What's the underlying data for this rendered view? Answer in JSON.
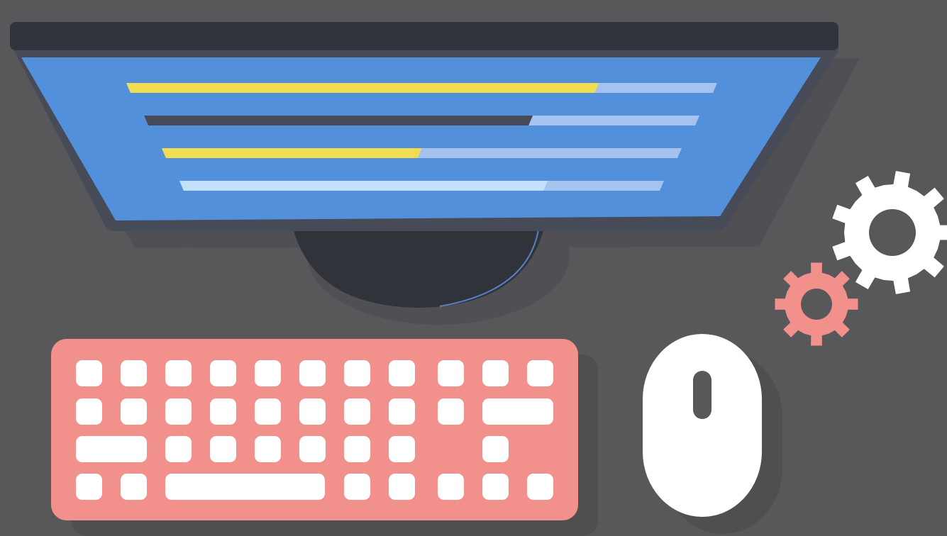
{
  "scene": {
    "colors": {
      "background": "#58585a",
      "monitor_frame": "#474b58",
      "monitor_top": "#31343c",
      "screen": "#5390db",
      "stand": "#31333b",
      "keyboard": "#f2918c",
      "keys": "#ffffff",
      "mouse": "#ffffff",
      "gear_large": "#ffffff",
      "gear_small": "#f2918c",
      "bar_yellow": "#f1dc52",
      "bar_dark": "#474b58",
      "bar_light": "#c4e1fb",
      "bar_track": "#a6c3ef"
    },
    "screen_bars": [
      {
        "fill_color": "yellow",
        "fill_fraction": 0.8
      },
      {
        "fill_color": "dark",
        "fill_fraction": 0.7
      },
      {
        "fill_color": "yellow",
        "fill_fraction": 0.5
      },
      {
        "fill_color": "light",
        "fill_fraction": 0.76
      }
    ],
    "icons": [
      "monitor-icon",
      "keyboard-icon",
      "mouse-icon",
      "gear-icon",
      "gear-icon"
    ]
  }
}
